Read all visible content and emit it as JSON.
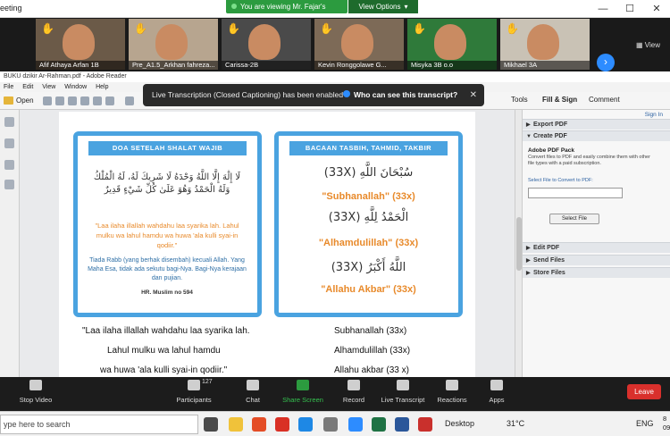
{
  "window": {
    "title": "eeting",
    "share_banner": "You are viewing Mr. Fajar's screen",
    "view_options": "View Options",
    "minimize": "—",
    "maximize": "☐",
    "close": "✕"
  },
  "video_strip": {
    "participants": [
      {
        "name": "Afif Athaya Arfan 1B",
        "bg": "#6b5a48"
      },
      {
        "name": "Pre_A1.5_Arkhan fahreza...",
        "bg": "#b7a58f"
      },
      {
        "name": "Carissa-2B",
        "bg": "#4a4a4a"
      },
      {
        "name": "Kevin Ronggolawe G...",
        "bg": "#7d6a57"
      },
      {
        "name": "Misyka 3B o.o",
        "bg": "#2f7a3a"
      },
      {
        "name": "Mikhael 3A",
        "bg": "#c9c2b5"
      }
    ],
    "view_label": "View"
  },
  "reader": {
    "title": "BUKU dzikir Ar-Rahman.pdf - Adobe Reader",
    "menu": [
      "File",
      "Edit",
      "View",
      "Window",
      "Help"
    ],
    "open": "Open",
    "tabs": {
      "tools": "Tools",
      "fill_sign": "Fill & Sign",
      "comment": "Comment"
    }
  },
  "transcription": {
    "message": "Live Transcription (Closed Captioning) has been enabled",
    "who": "Who can see this transcript?",
    "close": "✕"
  },
  "pdf": {
    "card1": {
      "heading": "DOA SETELAH SHALAT WAJIB",
      "arabic": "لَا إِلَٰهَ إِلَّا اللَّهُ وَحْدَهُ لَا شَرِيكَ لَهُ، لَهُ الْمُلْكُ وَلَهُ الْحَمْدُ وَهُوَ عَلَىٰ كُلِّ شَيْءٍ قَدِيرٌ",
      "latin": "\"Laa ilaha illallah wahdahu laa syarika lah. Lahul mulku wa lahul hamdu wa huwa 'ala kulli syai-in qodiir.\"",
      "translation": "Tiada Rabb (yang berhak disembah) kecuali Allah. Yang Maha Esa, tidak ada sekutu bagi-Nya. Bagi-Nya kerajaan dan pujian.",
      "source": "HR. Muslim no 594"
    },
    "card2": {
      "heading": "BACAAN TASBIH, TAHMID, TAKBIR",
      "items": [
        {
          "arabic": "سُبْحَانَ اللَّهِ (33X)",
          "latin": "\"Subhanallah\" (33x)"
        },
        {
          "arabic": "الْحَمْدُ لِلَّهِ (33X)",
          "latin": "\"Alhamdulillah\" (33x)"
        },
        {
          "arabic": "اللَّهُ أَكْبَرُ (33X)",
          "latin": "\"Allahu Akbar\" (33x)"
        }
      ]
    },
    "body_left": [
      "\"Laa ilaha illallah wahdahu laa syarika lah.",
      "Lahul mulku wa lahul hamdu",
      "wa huwa 'ala kulli syai-in qodiir.\""
    ],
    "body_right": [
      "Subhanallah (33x)",
      "Alhamdulillah (33x)",
      "Allahu akbar (33 x)"
    ]
  },
  "right_panel": {
    "sign_in": "Sign In",
    "export_pdf": "Export PDF",
    "create_pdf": "Create PDF",
    "pack_title": "Adobe PDF Pack",
    "pack_desc": "Convert files to PDF and easily combine them with other file types with a paid subscription.",
    "select_label": "Select File to Convert to PDF:",
    "select_button": "Select File",
    "edit_pdf": "Edit PDF",
    "send_files": "Send Files",
    "store_files": "Store Files"
  },
  "zoom_toolbar": {
    "stop_video": "Stop Video",
    "participants": "Participants",
    "participant_count": "127",
    "chat": "Chat",
    "share_screen": "Share Screen",
    "record": "Record",
    "live_transcript": "Live Transcript",
    "reactions": "Reactions",
    "apps": "Apps",
    "leave": "Leave"
  },
  "taskbar": {
    "search_placeholder": "ype here to search",
    "desktop": "Desktop",
    "weather": "31°C",
    "lang": "ENG",
    "time": "8",
    "date": "09/0"
  }
}
